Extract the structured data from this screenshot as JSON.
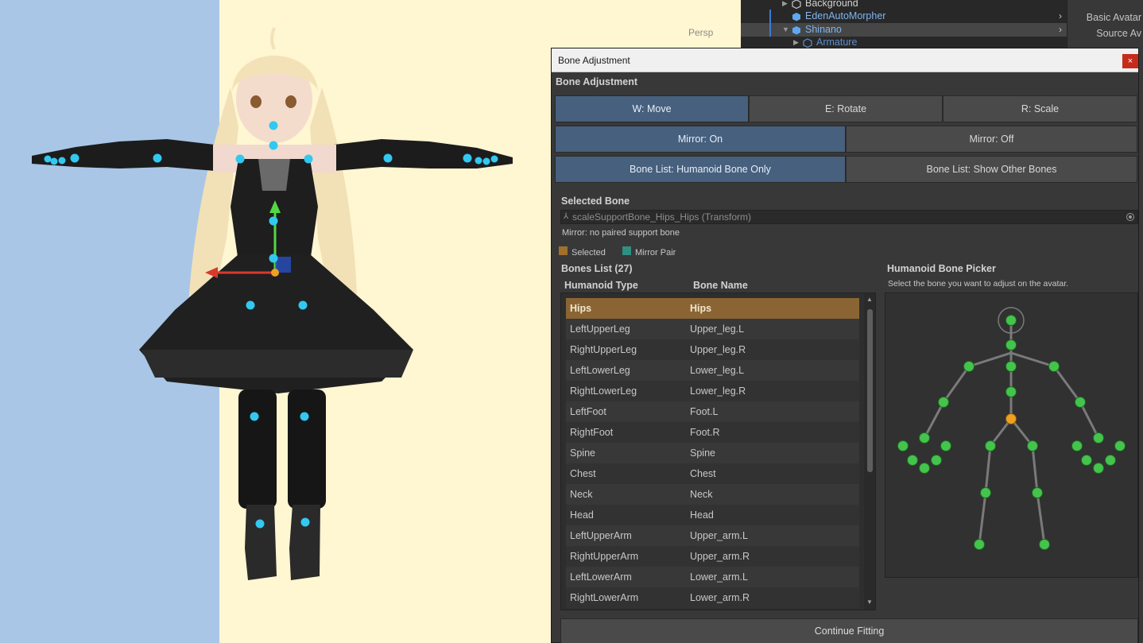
{
  "scene": {
    "persp_label": "Persp"
  },
  "hierarchy": {
    "items": [
      {
        "label": "Background",
        "color": "#d2d2d2"
      },
      {
        "label": "EdenAutoMorpher",
        "color": "#7fb4f0"
      },
      {
        "label": "Shinano",
        "color": "#7fb4f0"
      },
      {
        "label": "Armature",
        "color": "#5b8fd0"
      }
    ]
  },
  "inspector": {
    "labels": [
      "Basic Avatar",
      "Source Av"
    ]
  },
  "window": {
    "title": "Bone Adjustment",
    "close_icon": "×",
    "header": "Bone Adjustment",
    "mode_buttons": [
      {
        "label": "W: Move",
        "active": true
      },
      {
        "label": "E: Rotate",
        "active": false
      },
      {
        "label": "R: Scale",
        "active": false
      }
    ],
    "mirror_buttons": [
      {
        "label": "Mirror: On",
        "active": true
      },
      {
        "label": "Mirror: Off",
        "active": false
      }
    ],
    "bonelist_buttons": [
      {
        "label": "Bone List: Humanoid Bone Only",
        "active": true
      },
      {
        "label": "Bone List: Show Other Bones",
        "active": false
      }
    ],
    "selected_bone": {
      "title": "Selected Bone",
      "value": "scaleSupportBone_Hips_Hips (Transform)",
      "mirror_note": "Mirror: no paired support bone"
    },
    "legend": {
      "selected": "Selected",
      "selected_color": "#a0702c",
      "mirror_pair": "Mirror Pair",
      "mirror_pair_color": "#2f8f80"
    },
    "bones_list": {
      "title": "Bones List (27)",
      "col_type": "Humanoid Type",
      "col_name": "Bone Name",
      "rows": [
        {
          "type": "Hips",
          "name": "Hips"
        },
        {
          "type": "LeftUpperLeg",
          "name": "Upper_leg.L"
        },
        {
          "type": "RightUpperLeg",
          "name": "Upper_leg.R"
        },
        {
          "type": "LeftLowerLeg",
          "name": "Lower_leg.L"
        },
        {
          "type": "RightLowerLeg",
          "name": "Lower_leg.R"
        },
        {
          "type": "LeftFoot",
          "name": "Foot.L"
        },
        {
          "type": "RightFoot",
          "name": "Foot.R"
        },
        {
          "type": "Spine",
          "name": "Spine"
        },
        {
          "type": "Chest",
          "name": "Chest"
        },
        {
          "type": "Neck",
          "name": "Neck"
        },
        {
          "type": "Head",
          "name": "Head"
        },
        {
          "type": "LeftUpperArm",
          "name": "Upper_arm.L"
        },
        {
          "type": "RightUpperArm",
          "name": "Upper_arm.R"
        },
        {
          "type": "LeftLowerArm",
          "name": "Lower_arm.L"
        },
        {
          "type": "RightLowerArm",
          "name": "Lower_arm.R"
        }
      ]
    },
    "picker": {
      "title": "Humanoid Bone Picker",
      "subtitle": "Select the bone you want to adjust on the avatar.",
      "node_color": "#44c44c",
      "selected_color": "#f0a020"
    },
    "continue_label": "Continue Fitting"
  }
}
